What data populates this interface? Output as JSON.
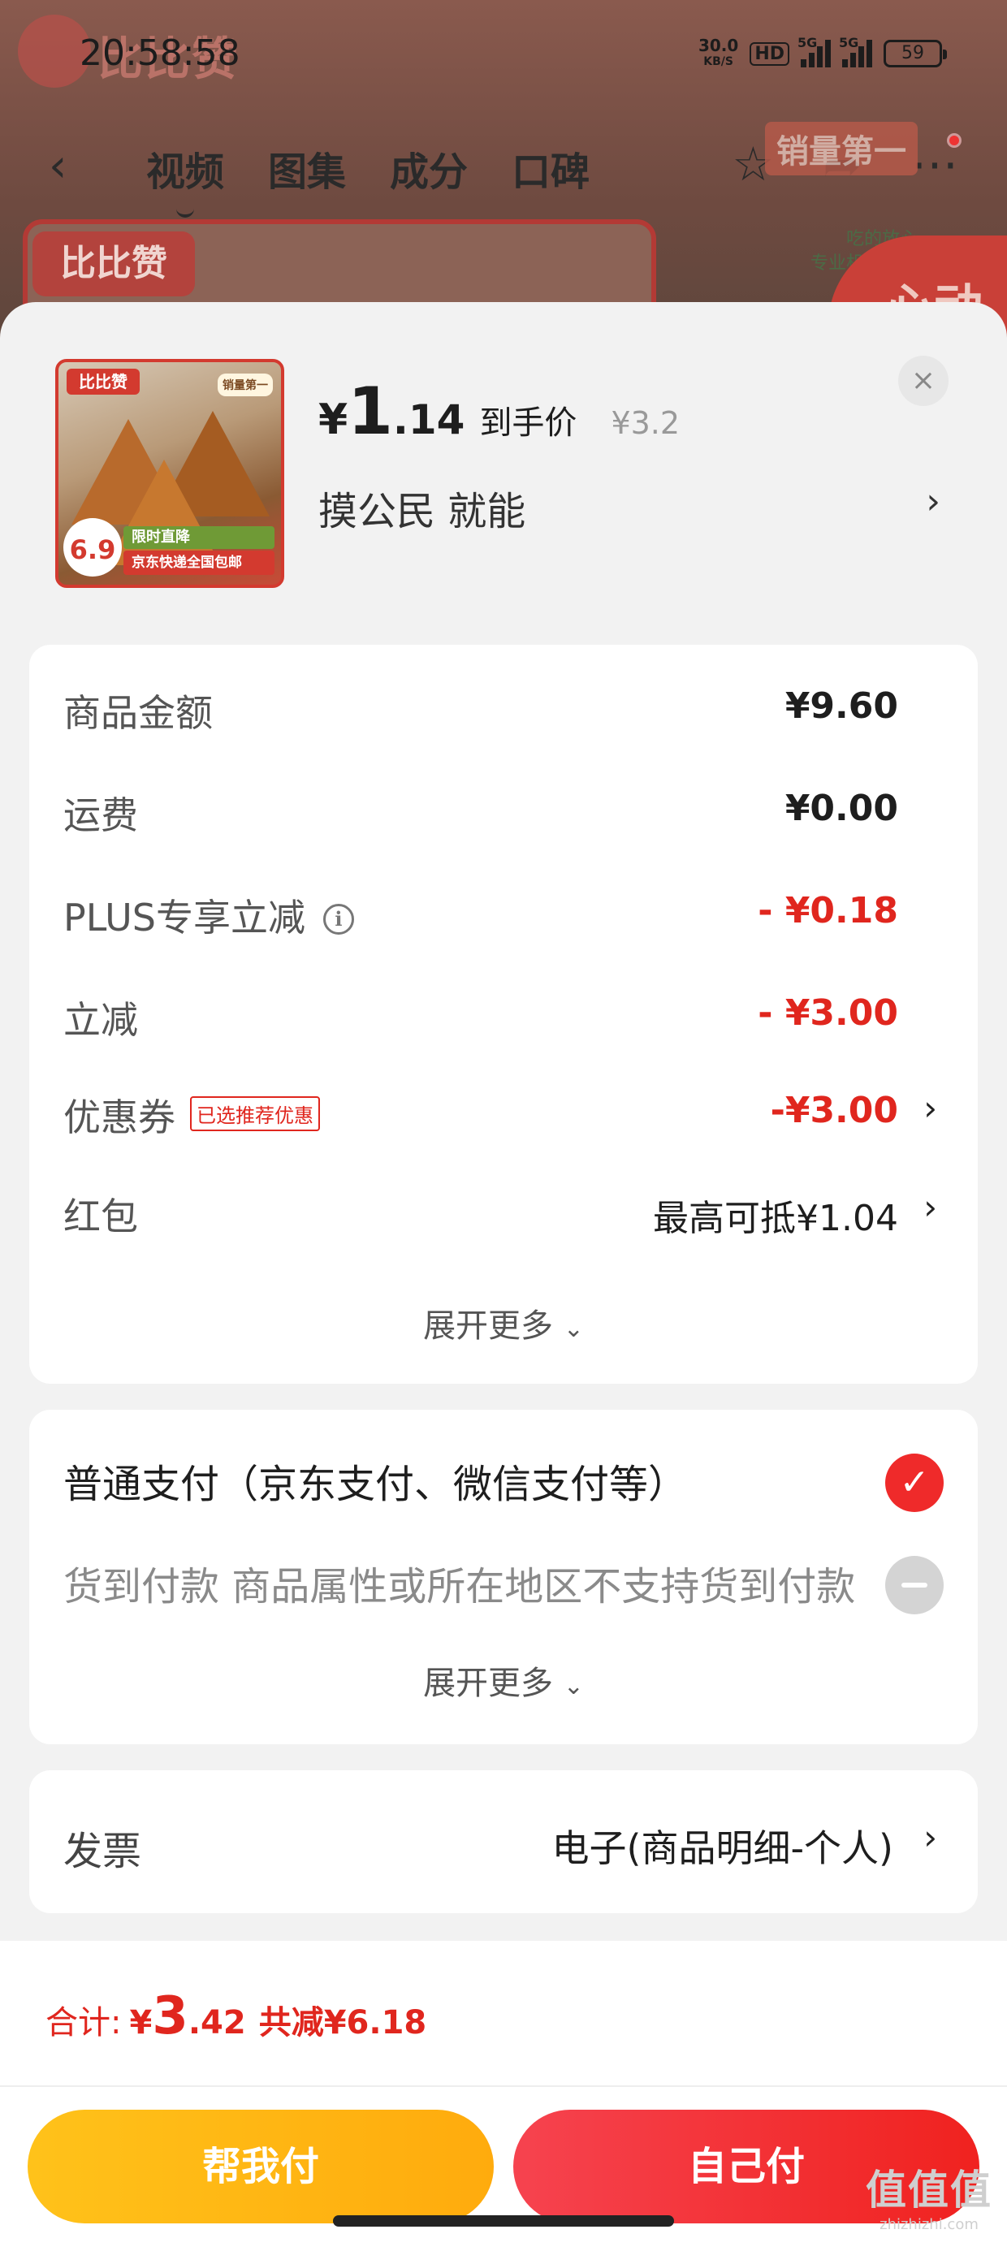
{
  "status_bar": {
    "time": "20:58:58",
    "net_speed": "30.0",
    "net_unit": "KB/S",
    "hd": "HD",
    "signal1": "5G",
    "signal2": "5G",
    "battery": "59"
  },
  "background": {
    "logo_text": "比比赞",
    "tabs": [
      "视频",
      "图集",
      "成分",
      "口碑"
    ],
    "badge": "销量第一",
    "side_text_1": "吃的放心",
    "side_text_2": "专业机构检测",
    "red_text": "心动",
    "card_logo": "比比赞"
  },
  "product": {
    "thumb_logo": "比比赞",
    "thumb_rank": "销量第一",
    "thumb_price": "6.9",
    "thumb_band": "限时直降",
    "thumb_band2": "京东快递全国包邮",
    "price_yen": "¥",
    "price_int": "1",
    "price_dec": ".14",
    "price_tag": "到手价",
    "price_original": "¥3.2",
    "seller": "摸公民  就能",
    "close": "×"
  },
  "summary": {
    "rows": [
      {
        "label": "商品金额",
        "value": "¥9.60"
      },
      {
        "label": "运费",
        "value": "¥0.00"
      },
      {
        "label": "PLUS专享立减",
        "value": "- ¥0.18"
      },
      {
        "label": "立减",
        "value": "- ¥3.00"
      },
      {
        "label": "优惠券",
        "tag": "已选推荐优惠",
        "value": "-¥3.00"
      },
      {
        "label": "红包",
        "value": "最高可抵¥1.04"
      }
    ],
    "expand": "展开更多"
  },
  "payment": {
    "option1": "普通支付（京东支付、微信支付等）",
    "option2": "货到付款  商品属性或所在地区不支持货到付款",
    "expand": "展开更多"
  },
  "invoice": {
    "label": "发票",
    "value": "电子(商品明细-个人)"
  },
  "footer": {
    "total_label": "合计:",
    "total_yen": "¥",
    "total_int": "3",
    "total_dec": ".42",
    "total_saved": "共减¥6.18",
    "help_pay": "帮我付",
    "self_pay": "自己付"
  },
  "watermark": {
    "main": "值值值",
    "sub": "zhizhizhi.com"
  },
  "colors": {
    "accent_red": "#e0261e",
    "help_button": "#ffb812",
    "self_button": "#f2302f"
  }
}
